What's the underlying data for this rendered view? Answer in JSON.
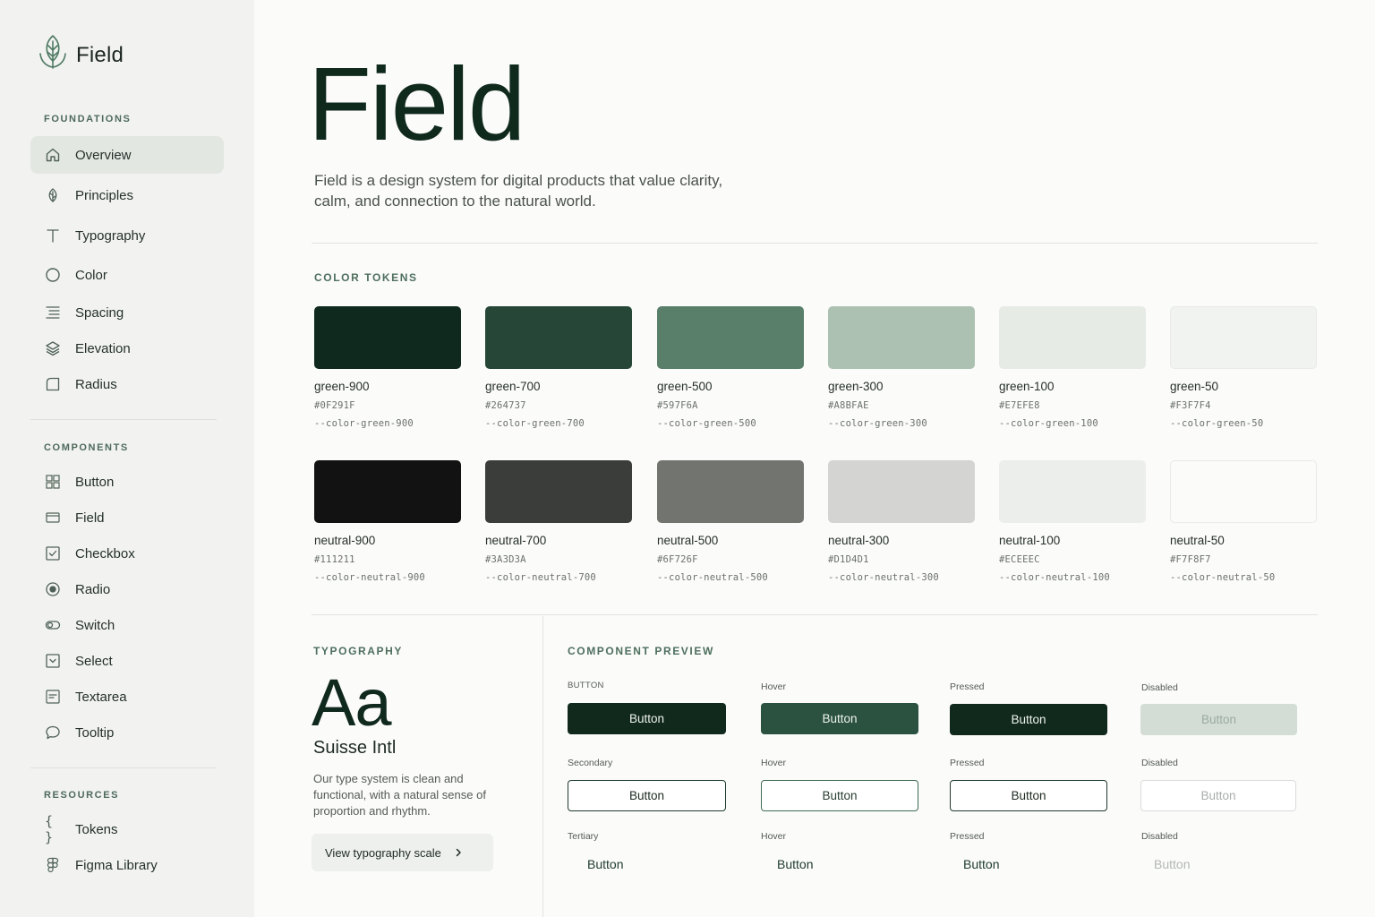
{
  "brand": {
    "name": "Field"
  },
  "sidebar": {
    "foundations_label": "FOUNDATIONS",
    "foundations": [
      {
        "label": "Overview",
        "icon": "home-icon",
        "active": true
      },
      {
        "label": "Principles",
        "icon": "leaf-icon"
      },
      {
        "label": "Typography",
        "icon": "type-icon"
      },
      {
        "label": "Color",
        "icon": "circle-icon"
      },
      {
        "label": "Spacing",
        "icon": "spacing-icon"
      },
      {
        "label": "Elevation",
        "icon": "layers-icon"
      },
      {
        "label": "Radius",
        "icon": "radius-icon"
      }
    ],
    "components_label": "COMPONENTS",
    "components": [
      {
        "label": "Button",
        "icon": "grid-icon"
      },
      {
        "label": "Field",
        "icon": "field-icon"
      },
      {
        "label": "Checkbox",
        "icon": "checkbox-icon"
      },
      {
        "label": "Radio",
        "icon": "radio-icon"
      },
      {
        "label": "Switch",
        "icon": "switch-icon"
      },
      {
        "label": "Select",
        "icon": "select-icon"
      },
      {
        "label": "Textarea",
        "icon": "textarea-icon"
      },
      {
        "label": "Tooltip",
        "icon": "tooltip-icon"
      }
    ],
    "resources_label": "RESOURCES",
    "resources": [
      {
        "label": "Tokens",
        "icon": "braces-icon"
      },
      {
        "label": "Figma Library",
        "icon": "figma-icon"
      }
    ]
  },
  "hero": {
    "title": "Field",
    "description": "Field is a design system for digital products that value clarity, calm, and connection to the natural world."
  },
  "color_tokens": {
    "label": "COLOR TOKENS",
    "green": [
      {
        "name": "green-900",
        "hex": "#0F291F",
        "var": "--color-green-900",
        "color": "#0f291f"
      },
      {
        "name": "green-700",
        "hex": "#264737",
        "var": "--color-green-700",
        "color": "#264737"
      },
      {
        "name": "green-500",
        "hex": "#597F6A",
        "var": "--color-green-500",
        "color": "#597f6a"
      },
      {
        "name": "green-300",
        "hex": "#A8BFAE",
        "var": "--color-green-300",
        "color": "#adc1b2"
      },
      {
        "name": "green-100",
        "hex": "#E7EFE8",
        "var": "--color-green-100",
        "color": "#e6ebe6"
      },
      {
        "name": "green-50",
        "hex": "#F3F7F4",
        "var": "--color-green-50",
        "color": "#f1f3f1"
      }
    ],
    "neutral": [
      {
        "name": "neutral-900",
        "hex": "#111211",
        "var": "--color-neutral-900",
        "color": "#111211"
      },
      {
        "name": "neutral-700",
        "hex": "#3A3D3A",
        "var": "--color-neutral-700",
        "color": "#3a3d3a"
      },
      {
        "name": "neutral-500",
        "hex": "#6F726F",
        "var": "--color-neutral-500",
        "color": "#72746f"
      },
      {
        "name": "neutral-300",
        "hex": "#D1D4D1",
        "var": "--color-neutral-300",
        "color": "#d4d4d2"
      },
      {
        "name": "neutral-100",
        "hex": "#ECEEEC",
        "var": "--color-neutral-100",
        "color": "#eceeec"
      },
      {
        "name": "neutral-50",
        "hex": "#F7F8F7",
        "var": "--color-neutral-50",
        "color": "#fbfbfa"
      }
    ]
  },
  "typography": {
    "label": "TYPOGRAPHY",
    "sample": "Aa",
    "font_name": "Suisse Intl",
    "description": "Our type system is clean and functional, with a natural sense of proportion and rhythm.",
    "button_label": "View typography scale"
  },
  "component_preview": {
    "label": "COMPONENT PREVIEW",
    "rows": [
      {
        "captions": [
          "BUTTON",
          "Hover",
          "Pressed",
          "Disabled"
        ],
        "button_label": "Button"
      },
      {
        "captions": [
          "Secondary",
          "Hover",
          "Pressed",
          "Disabled"
        ],
        "button_label": "Button"
      },
      {
        "captions": [
          "Tertiary",
          "Hover",
          "Pressed",
          "Disabled"
        ],
        "button_label": "Button"
      }
    ]
  }
}
